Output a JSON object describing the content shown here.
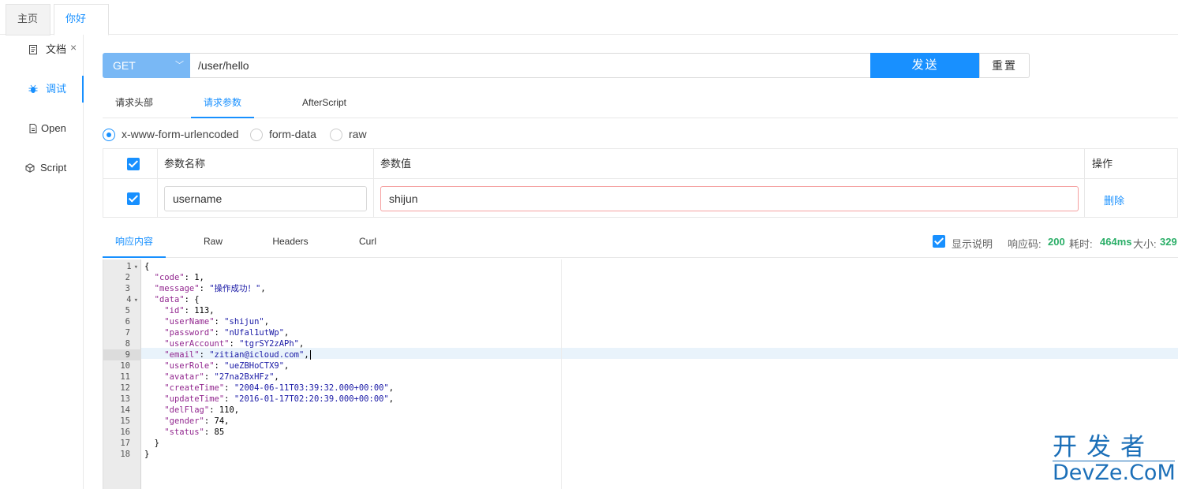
{
  "tabs": [
    {
      "label": "主页"
    },
    {
      "label": "你好",
      "close": "×"
    }
  ],
  "sidebar": {
    "items": [
      {
        "label": "文档",
        "icon": "document-icon"
      },
      {
        "label": "调试",
        "icon": "bug-icon",
        "active": true
      },
      {
        "label": "Open",
        "icon": "file-icon"
      },
      {
        "label": "Script",
        "icon": "cube-icon"
      }
    ]
  },
  "request": {
    "method": "GET",
    "url": "/user/hello",
    "send_label": "发送",
    "reset_label": "重置"
  },
  "request_tabs": [
    "请求头部",
    "请求参数",
    "AfterScript"
  ],
  "body_types": [
    "x-www-form-urlencoded",
    "form-data",
    "raw"
  ],
  "params": {
    "headers": {
      "name": "参数名称",
      "value": "参数值",
      "action": "操作"
    },
    "rows": [
      {
        "name": "username",
        "value": "shijun",
        "action": "删除"
      }
    ]
  },
  "response_tabs": [
    "响应内容",
    "Raw",
    "Headers",
    "Curl"
  ],
  "response_meta": {
    "show_desc": "显示说明",
    "code_label": "响应码:",
    "code": "200",
    "time_label": "耗时:",
    "time": "464ms",
    "size_label": "大小:",
    "size": "329"
  },
  "code_lines": [
    "{",
    "  \"code\": 1,",
    "  \"message\": \"操作成功！\",",
    "  \"data\": {",
    "    \"id\": 113,",
    "    \"userName\": \"shijun\",",
    "    \"password\": \"nUfal1utWp\",",
    "    \"userAccount\": \"tgrSY2zAPh\",",
    "    \"email\": \"zitian@icloud.com\",",
    "    \"userRole\": \"ueZBHoCTX9\",",
    "    \"avatar\": \"27na2BxHFz\",",
    "    \"createTime\": \"2004-06-11T03:39:32.000+00:00\",",
    "    \"updateTime\": \"2016-01-17T02:20:39.000+00:00\",",
    "    \"delFlag\": 110,",
    "    \"gender\": 74,",
    "    \"status\": 85",
    "  }",
    "}"
  ],
  "watermark": {
    "top": "开发者",
    "bottom": "DevZe.CoM"
  },
  "colors": {
    "accent": "#1890ff",
    "success": "#2aae67"
  }
}
